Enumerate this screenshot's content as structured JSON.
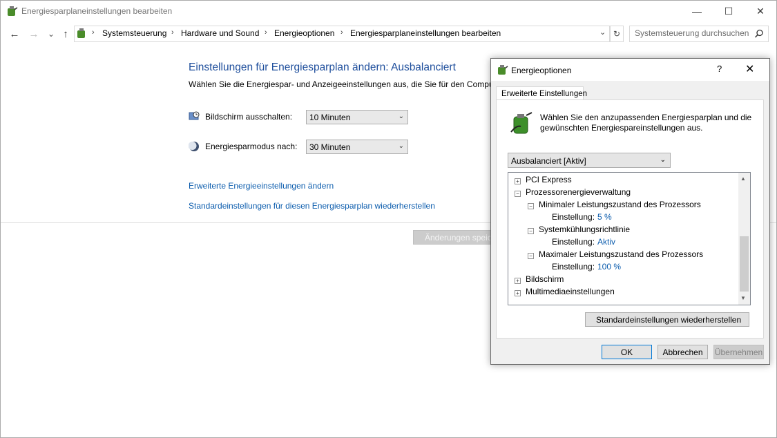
{
  "window": {
    "title": "Energiesparplaneinstellungen bearbeiten",
    "minimize": "—",
    "maximize": "☐",
    "close": "✕"
  },
  "nav": {
    "back": "←",
    "forward": "→",
    "recent": "⌄",
    "up": "↑",
    "breadcrumb": [
      "Systemsteuerung",
      "Hardware und Sound",
      "Energieoptionen",
      "Energiesparplaneinstellungen bearbeiten"
    ],
    "separator": "›",
    "dropdown": "⌄",
    "refresh": "↻",
    "search_placeholder": "Systemsteuerung durchsuchen"
  },
  "main": {
    "heading": "Einstellungen für Energiesparplan ändern: Ausbalanciert",
    "description": "Wählen Sie die Energiespar- und Anzeigeeinstellungen aus, die Sie für den Computer verwenden möchten.",
    "display_off_label": "Bildschirm ausschalten:",
    "display_off_value": "10 Minuten",
    "sleep_label": "Energiesparmodus nach:",
    "sleep_value": "30 Minuten",
    "link_advanced": "Erweiterte Energieeinstellungen ändern",
    "link_restore": "Standardeinstellungen für diesen Energiesparplan wiederherstellen",
    "save_button": "Änderungen speichern",
    "arrow": "⌄"
  },
  "dialog": {
    "title": "Energieoptionen",
    "help": "?",
    "close": "✕",
    "tab": "Erweiterte Einstellungen",
    "desc_line1": "Wählen Sie den anzupassenden Energiesparplan und die",
    "desc_line2": "gewünschten Energiespareinstellungen aus.",
    "plan": "Ausbalanciert [Aktiv]",
    "tree": {
      "pci": "PCI Express",
      "cpu": "Prozessorenergieverwaltung",
      "min_state": "Minimaler Leistungszustand des Prozessors",
      "setting_label": "Einstellung:",
      "min_value": "5 %",
      "cooling": "Systemkühlungsrichtlinie",
      "cooling_value": "Aktiv",
      "max_state": "Maximaler Leistungszustand des Prozessors",
      "max_value": "100 %",
      "display": "Bildschirm",
      "multimedia": "Multimediaeinstellungen",
      "plus": "+",
      "minus": "−",
      "scroll_up": "▲",
      "scroll_down": "▼"
    },
    "restore_button": "Standardeinstellungen wiederherstellen",
    "ok": "OK",
    "cancel": "Abbrechen",
    "apply": "Übernehmen"
  },
  "colors": {
    "link": "#0b5cad",
    "heading": "#1e4e9c"
  }
}
